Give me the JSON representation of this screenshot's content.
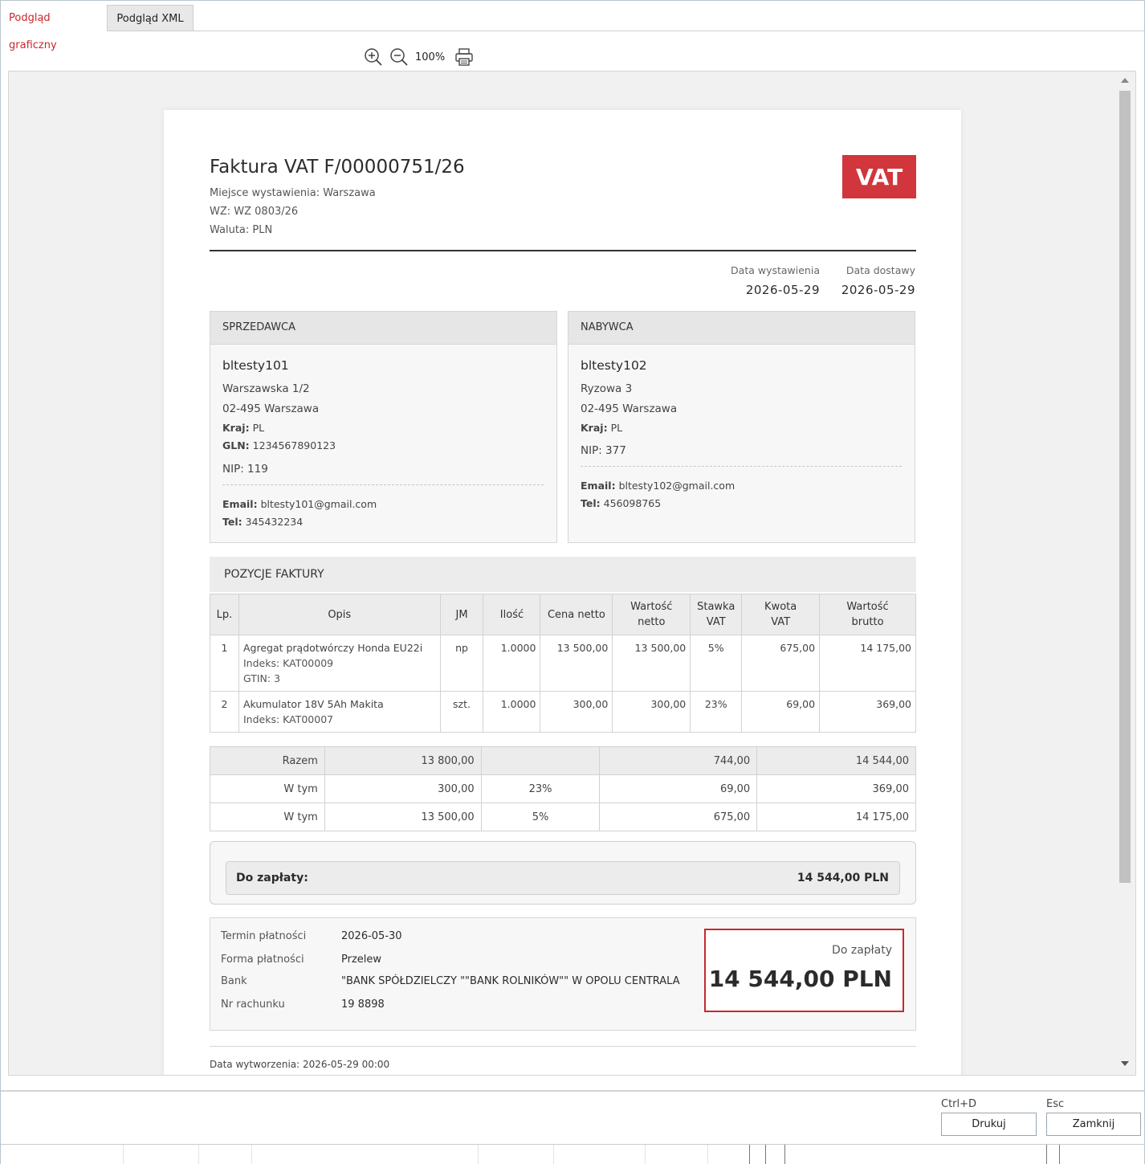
{
  "tabs": [
    {
      "label": "Podgląd graficzny",
      "active": true
    },
    {
      "label": "Podgląd XML",
      "active": false
    }
  ],
  "toolbar": {
    "zoom_in_icon": "zoom-in-icon",
    "zoom_out_icon": "zoom-out-icon",
    "zoom_level": "100%",
    "print_icon": "printer-icon"
  },
  "invoice": {
    "title": "Faktura VAT F/00000751/26",
    "place": "Miejsce wystawienia: Warszawa",
    "wz": "WZ: WZ 0803/26",
    "currency": "Waluta: PLN",
    "badge": "VAT",
    "issue_date_label": "Data wystawienia",
    "issue_date": "2026-05-29",
    "delivery_date_label": "Data dostawy",
    "delivery_date": "2026-05-29"
  },
  "seller": {
    "header": "SPRZEDAWCA",
    "name": "bltesty101",
    "street": "Warszawska 1/2",
    "city": "02-495 Warszawa",
    "country_label": "Kraj:",
    "country": "PL",
    "gln_label": "GLN:",
    "gln": "1234567890123",
    "nip": "NIP: 119",
    "email_label": "Email:",
    "email": "bltesty101@gmail.com",
    "tel_label": "Tel:",
    "tel": "345432234"
  },
  "buyer": {
    "header": "NABYWCA",
    "name": "bltesty102",
    "street": "Ryzowa 3",
    "city": "02-495 Warszawa",
    "country_label": "Kraj:",
    "country": "PL",
    "nip": "NIP: 377",
    "email_label": "Email:",
    "email": "bltesty102@gmail.com",
    "tel_label": "Tel:",
    "tel": "456098765"
  },
  "items_section": {
    "title": "POZYCJE FAKTURY",
    "columns": {
      "lp": "Lp.",
      "opis": "Opis",
      "jm": "JM",
      "ilosc": "Ilość",
      "cena": "Cena netto",
      "netto_1": "Wartość",
      "netto_2": "netto",
      "stawka_1": "Stawka",
      "stawka_2": "VAT",
      "kwota_1": "Kwota",
      "kwota_2": "VAT",
      "brutto_1": "Wartość",
      "brutto_2": "brutto"
    },
    "rows": [
      {
        "lp": "1",
        "name": "Agregat prądotwórczy Honda EU22i",
        "index": "Indeks: KAT00009",
        "gtin": "GTIN: 3",
        "jm": "np",
        "qty": "1.0000",
        "price": "13 500,00",
        "net": "13 500,00",
        "rate": "5%",
        "vat": "675,00",
        "gross": "14 175,00"
      },
      {
        "lp": "2",
        "name": "Akumulator 18V 5Ah Makita",
        "index": "Indeks: KAT00007",
        "jm": "szt.",
        "qty": "1.0000",
        "price": "300,00",
        "net": "300,00",
        "rate": "23%",
        "vat": "69,00",
        "gross": "369,00"
      }
    ]
  },
  "summary": [
    {
      "label": "Razem",
      "net": "13 800,00",
      "rate": "",
      "vat": "744,00",
      "gross": "14 544,00"
    },
    {
      "label": "W tym",
      "net": "300,00",
      "rate": "23%",
      "vat": "69,00",
      "gross": "369,00"
    },
    {
      "label": "W tym",
      "net": "13 500,00",
      "rate": "5%",
      "vat": "675,00",
      "gross": "14 175,00"
    }
  ],
  "to_pay": {
    "label": "Do zapłaty:",
    "value": "14 544,00 PLN"
  },
  "payment": {
    "term_label": "Termin płatności",
    "term": "2026-05-30",
    "form_label": "Forma płatności",
    "form": "Przelew",
    "bank_label": "Bank",
    "bank": "\"BANK SPÓŁDZIELCZY \"\"BANK ROLNIKÓW\"\" W OPOLU CENTRALA",
    "account_label": "Nr rachunku",
    "account": "19 8898",
    "due_title": "Do zapłaty",
    "due_amount": "14 544,00 PLN"
  },
  "created": "Data wytworzenia: 2026-05-29 00:00",
  "footer": {
    "print_shortcut": "Ctrl+D",
    "print_label": "Drukuj",
    "close_shortcut": "Esc",
    "close_label": "Zamknij"
  },
  "colors": {
    "accent_red": "#c8282d",
    "badge_red": "#d0363c"
  }
}
